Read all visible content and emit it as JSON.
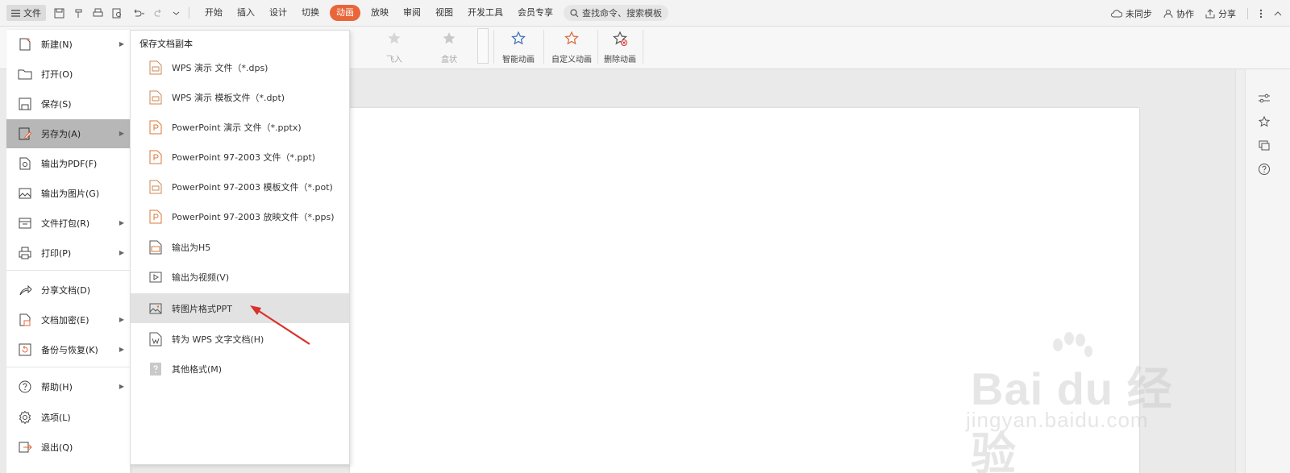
{
  "topbar": {
    "file_label": "文件",
    "tabs": [
      "开始",
      "插入",
      "设计",
      "切换",
      "动画",
      "放映",
      "审阅",
      "视图",
      "开发工具",
      "会员专享"
    ],
    "active_tab": "动画",
    "search_label": "查找命令、搜索模板",
    "sync_label": "未同步",
    "collab_label": "协作",
    "share_label": "分享"
  },
  "ribbon": {
    "gallery_items": [
      "飞入",
      "盒状"
    ],
    "smart_animation": "智能动画",
    "custom_animation": "自定义动画",
    "delete_animation": "删除动画"
  },
  "file_menu": {
    "items": [
      {
        "label": "新建(N)",
        "icon": "new-file-icon",
        "submenu": true
      },
      {
        "label": "打开(O)",
        "icon": "folder-open-icon",
        "submenu": false
      },
      {
        "label": "保存(S)",
        "icon": "save-icon",
        "submenu": false
      },
      {
        "label": "另存为(A)",
        "icon": "save-as-icon",
        "submenu": true
      },
      {
        "label": "输出为PDF(F)",
        "icon": "export-pdf-icon",
        "submenu": false
      },
      {
        "label": "输出为图片(G)",
        "icon": "export-image-icon",
        "submenu": false
      },
      {
        "label": "文件打包(R)",
        "icon": "package-icon",
        "submenu": true
      },
      {
        "label": "打印(P)",
        "icon": "print-icon",
        "submenu": true
      },
      {
        "label": "分享文档(D)",
        "icon": "share-icon",
        "submenu": false
      },
      {
        "label": "文档加密(E)",
        "icon": "encrypt-icon",
        "submenu": true
      },
      {
        "label": "备份与恢复(K)",
        "icon": "backup-icon",
        "submenu": true
      },
      {
        "label": "帮助(H)",
        "icon": "help-icon",
        "submenu": true
      },
      {
        "label": "选项(L)",
        "icon": "settings-icon",
        "submenu": false
      },
      {
        "label": "退出(Q)",
        "icon": "exit-icon",
        "submenu": false
      }
    ],
    "active_item": "另存为(A)"
  },
  "save_as_submenu": {
    "title": "保存文档副本",
    "items": [
      {
        "label": "WPS 演示 文件（*.dps)",
        "icon": "wps-file-icon"
      },
      {
        "label": "WPS 演示 模板文件（*.dpt)",
        "icon": "wps-template-icon"
      },
      {
        "label": "PowerPoint 演示 文件（*.pptx)",
        "icon": "pptx-file-icon"
      },
      {
        "label": "PowerPoint 97-2003 文件（*.ppt)",
        "icon": "ppt-file-icon"
      },
      {
        "label": "PowerPoint 97-2003 模板文件（*.pot)",
        "icon": "pot-file-icon"
      },
      {
        "label": "PowerPoint 97-2003 放映文件（*.pps)",
        "icon": "pps-file-icon"
      },
      {
        "label": "输出为H5",
        "icon": "h5-icon"
      },
      {
        "label": "输出为视频(V)",
        "icon": "video-icon"
      },
      {
        "label": "转图片格式PPT",
        "icon": "image-ppt-icon"
      },
      {
        "label": "转为 WPS 文字文档(H)",
        "icon": "wps-writer-icon"
      },
      {
        "label": "其他格式(M)",
        "icon": "other-format-icon"
      }
    ],
    "highlighted_item": "转图片格式PPT"
  },
  "watermark": {
    "line1": "Bai du 经验",
    "line2": "jingyan.baidu.com"
  },
  "colors": {
    "accent": "#e8663a",
    "annotation_arrow": "#d9312b",
    "menu_active": "#b7b7b7"
  }
}
